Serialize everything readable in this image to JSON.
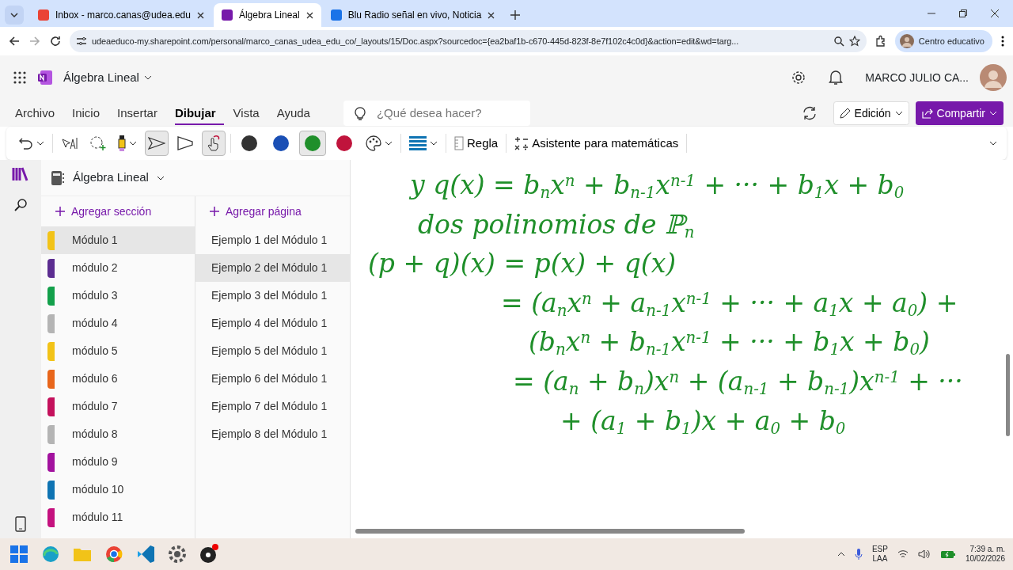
{
  "browser": {
    "tabs": [
      {
        "title": "Inbox - marco.canas@udea.edu",
        "selected": false,
        "color": "#ea4335"
      },
      {
        "title": "Álgebra Lineal",
        "selected": true,
        "color": "#7719aa"
      },
      {
        "title": "Blu Radio señal en vivo, Noticia",
        "selected": false,
        "color": "#1a73e8"
      }
    ],
    "url": "udeaeduco-my.sharepoint.com/personal/marco_canas_udea_edu_co/_layouts/15/Doc.aspx?sourcedoc={ea2baf1b-c670-445d-823f-8e7f102c4c0d}&action=edit&wd=targ...",
    "profile": "Centro educativo"
  },
  "app": {
    "title": "Álgebra Lineal",
    "user": "MARCO JULIO CA..."
  },
  "ribbon": {
    "tabs": [
      {
        "label": "Archivo",
        "selected": false
      },
      {
        "label": "Inicio",
        "selected": false
      },
      {
        "label": "Insertar",
        "selected": false
      },
      {
        "label": "Dibujar",
        "selected": true
      },
      {
        "label": "Vista",
        "selected": false
      },
      {
        "label": "Ayuda",
        "selected": false
      }
    ],
    "search_placeholder": "¿Qué desea hacer?",
    "edit_button": "Edición",
    "share_button": "Compartir",
    "pens": [
      {
        "color": "#333333",
        "selected": false
      },
      {
        "color": "#1a4fb5",
        "selected": false
      },
      {
        "color": "#1f8f2a",
        "selected": true
      },
      {
        "color": "#c0143c",
        "selected": false
      }
    ],
    "ruler": "Regla",
    "math": "Asistente para matemáticas"
  },
  "notebook": {
    "title": "Álgebra Lineal",
    "add_section": "Agregar sección",
    "add_page": "Agregar página",
    "sections": [
      {
        "name": "Módulo 1",
        "color": "#f2c318",
        "selected": true
      },
      {
        "name": "módulo 2",
        "color": "#5c2d91",
        "selected": false
      },
      {
        "name": "módulo 3",
        "color": "#13a04b",
        "selected": false
      },
      {
        "name": "módulo 4",
        "color": "#b4b4b4",
        "selected": false
      },
      {
        "name": "módulo 5",
        "color": "#f2c318",
        "selected": false
      },
      {
        "name": "módulo 6",
        "color": "#e8661b",
        "selected": false
      },
      {
        "name": "módulo 7",
        "color": "#c4115c",
        "selected": false
      },
      {
        "name": "módulo 8",
        "color": "#b4b4b4",
        "selected": false
      },
      {
        "name": "módulo 9",
        "color": "#a2129e",
        "selected": false
      },
      {
        "name": "módulo 10",
        "color": "#0f74b3",
        "selected": false
      },
      {
        "name": "módulo 11",
        "color": "#c4117e",
        "selected": false
      }
    ],
    "pages": [
      {
        "title": "Ejemplo 1 del Módulo 1",
        "selected": false
      },
      {
        "title": "Ejemplo 2 del Módulo 1",
        "selected": true
      },
      {
        "title": "Ejemplo 3 del Módulo 1",
        "selected": false
      },
      {
        "title": "Ejemplo 4 del Módulo 1",
        "selected": false
      },
      {
        "title": "Ejemplo 5 del Módulo 1",
        "selected": false
      },
      {
        "title": "Ejemplo 6 del Módulo 1",
        "selected": false
      },
      {
        "title": "Ejemplo 7 del Módulo 1",
        "selected": false
      },
      {
        "title": "Ejemplo 8 del Módulo 1",
        "selected": false
      }
    ]
  },
  "ink": {
    "lines": [
      "y q(x) = b$_{n}$x$^{n}$ + b$_{n-1}$x$^{n-1}$ + ··· + b$_{1}$x + b$_{0}$",
      "dos polinomios de ℙ$_{n}$",
      "(p + q)(x) = p(x) + q(x)",
      "= (a$_{n}$x$^{n}$ + a$_{n-1}$x$^{n-1}$ + ··· + a$_{1}$x + a$_{0}$) +",
      "(b$_{n}$x$^{n}$ + b$_{n-1}$x$^{n-1}$ + ··· + b$_{1}$x + b$_{0}$)",
      "= (a$_{n}$ + b$_{n}$)x$^{n}$ + (a$_{n-1}$ + b$_{n-1}$)x$^{n-1}$ + ···",
      "+ (a$_{1}$ + b$_{1}$)x + a$_{0}$ + b$_{0}$"
    ]
  },
  "taskbar": {
    "lang_top": "ESP",
    "lang_bottom": "LAA",
    "time": "7:39 a. m.",
    "date": "10/02/2026"
  }
}
